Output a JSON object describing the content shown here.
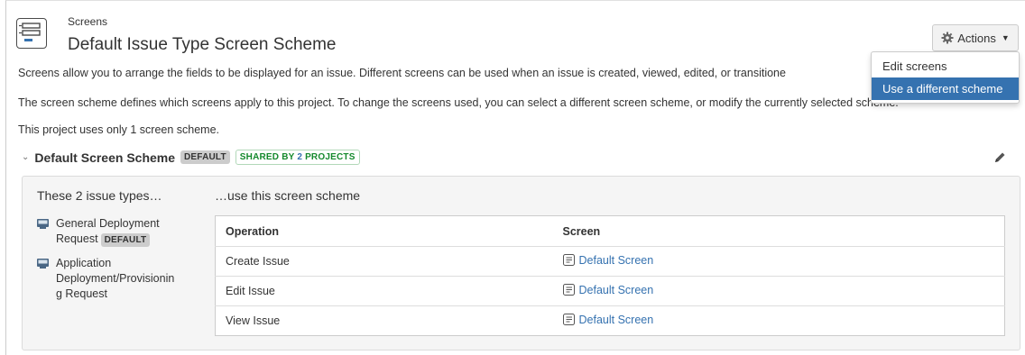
{
  "header": {
    "breadcrumb": "Screens",
    "title": "Default Issue Type Screen Scheme",
    "icon": "screen-scheme-icon"
  },
  "actions": {
    "label": "Actions",
    "icon": "gear-icon",
    "menu": [
      {
        "label": "Edit screens",
        "active": false
      },
      {
        "label": "Use a different scheme",
        "active": true
      }
    ]
  },
  "description": {
    "line1": "Screens allow you to arrange the fields to be displayed for an issue. Different screens can be used when an issue is created, viewed, edited, or transitione",
    "line2": "The screen scheme defines which screens apply to this project. To change the screens used, you can select a different screen scheme, or modify the currently selected scheme.",
    "line3": "This project uses only 1 screen scheme."
  },
  "scheme": {
    "name": "Default Screen Scheme",
    "default_badge": "DEFAULT",
    "shared_prefix": "SHARED BY",
    "shared_count": "2",
    "shared_suffix": "PROJECTS"
  },
  "panel": {
    "left_heading": "These 2 issue types…",
    "right_heading": "…use this screen scheme",
    "issue_types": [
      {
        "lines": [
          "General Deployment",
          "Request"
        ],
        "badge": "DEFAULT"
      },
      {
        "lines": [
          "Application",
          "Deployment/Provisionin",
          "g Request"
        ],
        "badge": ""
      }
    ],
    "table": {
      "headers": [
        "Operation",
        "Screen"
      ],
      "rows": [
        {
          "operation": "Create Issue",
          "screen": "Default Screen"
        },
        {
          "operation": "Edit Issue",
          "screen": "Default Screen"
        },
        {
          "operation": "View Issue",
          "screen": "Default Screen"
        }
      ]
    }
  },
  "colors": {
    "link": "#3572b0",
    "menu_active": "#3572b0",
    "shared_green": "#14892c"
  }
}
